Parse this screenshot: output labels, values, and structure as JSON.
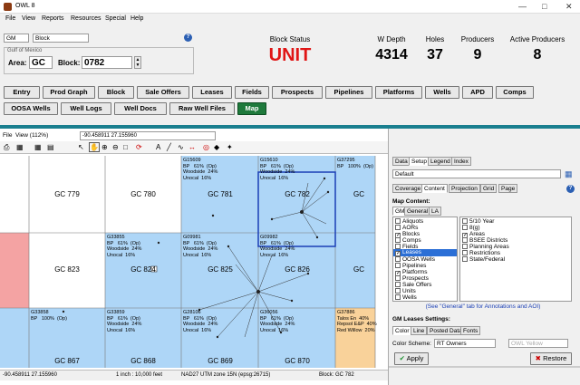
{
  "app": {
    "title": "OWL 8",
    "menu": [
      "File",
      "View",
      "Reports",
      "Resources",
      "Special",
      "Help"
    ]
  },
  "controls": {
    "area_type": "GM",
    "level": "Block",
    "region": "Gulf of Mexico",
    "area_label": "Area:",
    "area_value": "GC",
    "block_label": "Block:",
    "block_value": "0782",
    "help": "?"
  },
  "stats": [
    {
      "label": "Block Status",
      "value": "UNIT",
      "color": "#e01515"
    },
    {
      "label": "W Depth",
      "value": "4314"
    },
    {
      "label": "Holes",
      "value": "37"
    },
    {
      "label": "Producers",
      "value": "9"
    },
    {
      "label": "Active Producers",
      "value": "8"
    }
  ],
  "buttons_row1": [
    "Entry",
    "Prod Graph",
    "Block",
    "Sale Offers",
    "Leases",
    "Fields",
    "Prospects",
    "Pipelines",
    "Platforms",
    "Wells",
    "APD",
    "Comps"
  ],
  "buttons_row2": [
    "OOSA Wells",
    "Well Logs",
    "Well Docs",
    "Raw Well Files",
    "Map"
  ],
  "map": {
    "menu": [
      "File",
      "View (112%)"
    ],
    "coord_field": "-90.458911  27.155960",
    "blocks_row1": [
      "GC 779",
      "GC 780",
      "GC 781",
      "GC 782",
      "GC"
    ],
    "blocks_row2": [
      "GC 823",
      "GC 824",
      "GC 825",
      "GC 826",
      "GC"
    ],
    "blocks_row3": [
      "GC 867",
      "GC 868",
      "GC 869",
      "GC 870"
    ],
    "leases": [
      "G15609\nBP   61%  (Op)\nWoodside  24%\nUnocal  16%",
      "G15610\nBP   61%  (Op)\nWoodside  24%\nUnocal  16%",
      "G37295\nBP   100%  (Op)",
      "G33855\nBP   61%  (Op)\nWoodside  24%\nUnocal  16%",
      "G09981\nBP   61%  (Op)\nWoodside  24%\nUnocal  16%",
      "G09982\nBP   61%  (Op)\nWoodside  24%\nUnocal  16%",
      "G33858\nBP   100%  (Op)",
      "G33859\nBP   61%  (Op)\nWoodside  24%\nUnocal  16%",
      "G28106\nBP   61%  (Op)\nWoodside  24%\nUnocal  16%",
      "G36056\nBP   61%  (Op)\nWoodside  24%\nUnocal  16%",
      "G37886\nTalos En  40%\nRepsol E&P  40%\nRed Willow  20%"
    ],
    "status": [
      "-90.458911  27.155960",
      "1 inch : 10,000 feet",
      "NAD27 UTM zone 15N (epsg:26715)",
      "Block: GC 782"
    ]
  },
  "panel": {
    "tabs": [
      "Data",
      "Setup",
      "Legend",
      "Index"
    ],
    "preset": "Default",
    "subtabs": [
      "Coverage",
      "Content",
      "Projection",
      "Grid",
      "Page"
    ],
    "map_content_label": "Map Content:",
    "content_tabs": [
      "GM",
      "General",
      "LA"
    ],
    "left_items": [
      {
        "label": "Aliquots",
        "checked": false
      },
      {
        "label": "AORs",
        "checked": false
      },
      {
        "label": "Blocks",
        "checked": true
      },
      {
        "label": "Comps",
        "checked": false
      },
      {
        "label": "Fields",
        "checked": false
      },
      {
        "label": "Leases",
        "checked": true,
        "selected": true
      },
      {
        "label": "OOSA Wells",
        "checked": false
      },
      {
        "label": "Pipelines",
        "checked": false
      },
      {
        "label": "Platforms",
        "checked": true
      },
      {
        "label": "Prospects",
        "checked": false
      },
      {
        "label": "Sale Offers",
        "checked": false
      },
      {
        "label": "Units",
        "checked": false
      },
      {
        "label": "Wells",
        "checked": false
      }
    ],
    "right_items": [
      {
        "label": "5/10 Year",
        "checked": false
      },
      {
        "label": "8(g)",
        "checked": false
      },
      {
        "label": "Areas",
        "checked": true
      },
      {
        "label": "BSEE Districts",
        "checked": false
      },
      {
        "label": "Planning Areas",
        "checked": false
      },
      {
        "label": "Restrictions",
        "checked": false
      },
      {
        "label": "State/Federal",
        "checked": false
      }
    ],
    "note": "(See \"General\" tab for Annotations and AOI)",
    "settings_title": "GM Leases Settings:",
    "settings_tabs": [
      "Color",
      "Line",
      "Posted Data",
      "Fonts"
    ],
    "scheme_label": "Color Scheme:",
    "scheme_value": "RT Owners",
    "scheme_color": "OWL Yellow",
    "apply": "Apply",
    "restore": "Restore"
  }
}
